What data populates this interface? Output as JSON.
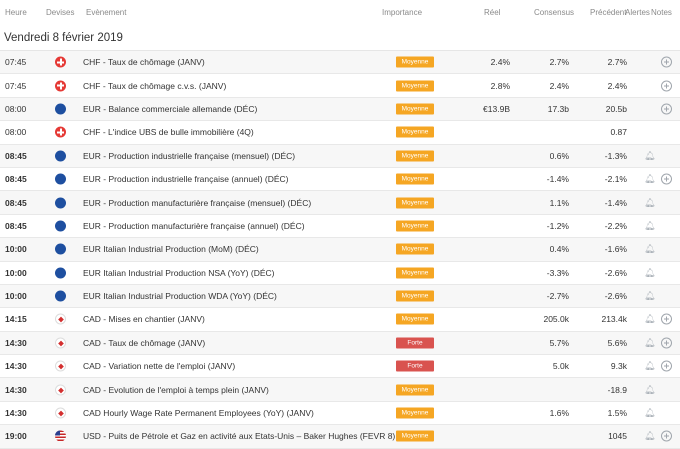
{
  "headers": {
    "time": "Heure",
    "currency": "Devises",
    "event": "Evènement",
    "importance": "Importance",
    "actual": "Réel",
    "consensus": "Consensus",
    "previous": "Précédent",
    "alerts": "Alertes",
    "notes": "Notes"
  },
  "date": "Vendredi 8 février 2019",
  "rows": [
    {
      "time": "07:45",
      "bold": false,
      "currency": "chf",
      "event": "CHF - Taux de chômage (JANV)",
      "importance": "Moyenne",
      "level": "moyenne",
      "actual": "2.4%",
      "consensus": "2.7%",
      "previous": "2.7%",
      "bell": false,
      "plus": true
    },
    {
      "time": "07:45",
      "bold": false,
      "currency": "chf",
      "event": "CHF - Taux de chômage c.v.s. (JANV)",
      "importance": "Moyenne",
      "level": "moyenne",
      "actual": "2.8%",
      "consensus": "2.4%",
      "previous": "2.4%",
      "bell": false,
      "plus": true
    },
    {
      "time": "08:00",
      "bold": false,
      "currency": "eur",
      "event": "EUR - Balance commerciale allemande (DÉC)",
      "importance": "Moyenne",
      "level": "moyenne",
      "actual": "€13.9B",
      "consensus": "17.3b",
      "previous": "20.5b",
      "bell": false,
      "plus": true
    },
    {
      "time": "08:00",
      "bold": false,
      "currency": "chf",
      "event": "CHF - L'indice UBS de bulle immobilière (4Q)",
      "importance": "Moyenne",
      "level": "moyenne",
      "actual": "",
      "consensus": "",
      "previous": "0.87",
      "bell": false,
      "plus": false
    },
    {
      "time": "08:45",
      "bold": true,
      "currency": "eur",
      "event": "EUR - Production industrielle française (mensuel) (DÉC)",
      "importance": "Moyenne",
      "level": "moyenne",
      "actual": "",
      "consensus": "0.6%",
      "previous": "-1.3%",
      "bell": true,
      "plus": false
    },
    {
      "time": "08:45",
      "bold": true,
      "currency": "eur",
      "event": "EUR - Production industrielle française (annuel) (DÉC)",
      "importance": "Moyenne",
      "level": "moyenne",
      "actual": "",
      "consensus": "-1.4%",
      "previous": "-2.1%",
      "bell": true,
      "plus": true
    },
    {
      "time": "08:45",
      "bold": true,
      "currency": "eur",
      "event": "EUR - Production manufacturière française (mensuel) (DÉC)",
      "importance": "Moyenne",
      "level": "moyenne",
      "actual": "",
      "consensus": "1.1%",
      "previous": "-1.4%",
      "bell": true,
      "plus": false
    },
    {
      "time": "08:45",
      "bold": true,
      "currency": "eur",
      "event": "EUR - Production manufacturière française (annuel) (DÉC)",
      "importance": "Moyenne",
      "level": "moyenne",
      "actual": "",
      "consensus": "-1.2%",
      "previous": "-2.2%",
      "bell": true,
      "plus": false
    },
    {
      "time": "10:00",
      "bold": true,
      "currency": "eur",
      "event": "EUR Italian Industrial Production (MoM) (DÉC)",
      "importance": "Moyenne",
      "level": "moyenne",
      "actual": "",
      "consensus": "0.4%",
      "previous": "-1.6%",
      "bell": true,
      "plus": false
    },
    {
      "time": "10:00",
      "bold": true,
      "currency": "eur",
      "event": "EUR Italian Industrial Production NSA (YoY) (DÉC)",
      "importance": "Moyenne",
      "level": "moyenne",
      "actual": "",
      "consensus": "-3.3%",
      "previous": "-2.6%",
      "bell": true,
      "plus": false
    },
    {
      "time": "10:00",
      "bold": true,
      "currency": "eur",
      "event": "EUR Italian Industrial Production WDA (YoY) (DÉC)",
      "importance": "Moyenne",
      "level": "moyenne",
      "actual": "",
      "consensus": "-2.7%",
      "previous": "-2.6%",
      "bell": true,
      "plus": false
    },
    {
      "time": "14:15",
      "bold": true,
      "currency": "cad",
      "event": "CAD - Mises en chantier (JANV)",
      "importance": "Moyenne",
      "level": "moyenne",
      "actual": "",
      "consensus": "205.0k",
      "previous": "213.4k",
      "bell": true,
      "plus": true
    },
    {
      "time": "14:30",
      "bold": true,
      "currency": "cad",
      "event": "CAD - Taux de chômage (JANV)",
      "importance": "Forte",
      "level": "forte",
      "actual": "",
      "consensus": "5.7%",
      "previous": "5.6%",
      "bell": true,
      "plus": true
    },
    {
      "time": "14:30",
      "bold": true,
      "currency": "cad",
      "event": "CAD - Variation nette de l'emploi (JANV)",
      "importance": "Forte",
      "level": "forte",
      "actual": "",
      "consensus": "5.0k",
      "previous": "9.3k",
      "bell": true,
      "plus": true
    },
    {
      "time": "14:30",
      "bold": true,
      "currency": "cad",
      "event": "CAD - Evolution de l'emploi à temps plein (JANV)",
      "importance": "Moyenne",
      "level": "moyenne",
      "actual": "",
      "consensus": "",
      "previous": "-18.9",
      "bell": true,
      "plus": false
    },
    {
      "time": "14:30",
      "bold": true,
      "currency": "cad",
      "event": "CAD Hourly Wage Rate Permanent Employees (YoY) (JANV)",
      "importance": "Moyenne",
      "level": "moyenne",
      "actual": "",
      "consensus": "1.6%",
      "previous": "1.5%",
      "bell": true,
      "plus": false
    },
    {
      "time": "19:00",
      "bold": true,
      "currency": "usd",
      "event": "USD - Puits de Pétrole et Gaz en activité aux Etats-Unis – Baker Hughes (FEVR 8)",
      "importance": "Moyenne",
      "level": "moyenne",
      "actual": "",
      "consensus": "",
      "previous": "1045",
      "bell": true,
      "plus": true
    }
  ]
}
